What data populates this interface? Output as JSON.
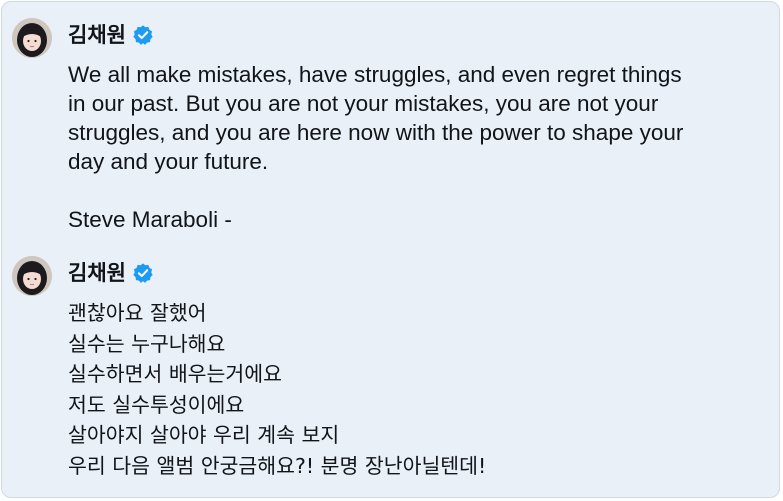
{
  "messages": [
    {
      "author": "김채원",
      "verified": true,
      "lines": [
        "We all make mistakes, have struggles, and even regret things",
        "in our past. But you are not your mistakes, you are not your",
        "struggles, and you are here now with the power to shape your",
        "day and your future."
      ],
      "attribution": "Steve Maraboli -"
    },
    {
      "author": "김채원",
      "verified": true,
      "lines": [
        "괜찮아요 잘했어",
        "실수는 누구나해요",
        "실수하면서 배우는거에요",
        "저도 실수투성이에요",
        "살아야지 살아야 우리 계속 보지",
        "우리 다음 앨범 안궁금해요?! 분명 장난아닐텐데!"
      ]
    }
  ],
  "colors": {
    "background": "#e9f0f8",
    "text": "#111418",
    "verified_badge": "#1d9bf0"
  },
  "icons": {
    "verified": "verified-badge-icon",
    "avatar": "profile-avatar"
  }
}
